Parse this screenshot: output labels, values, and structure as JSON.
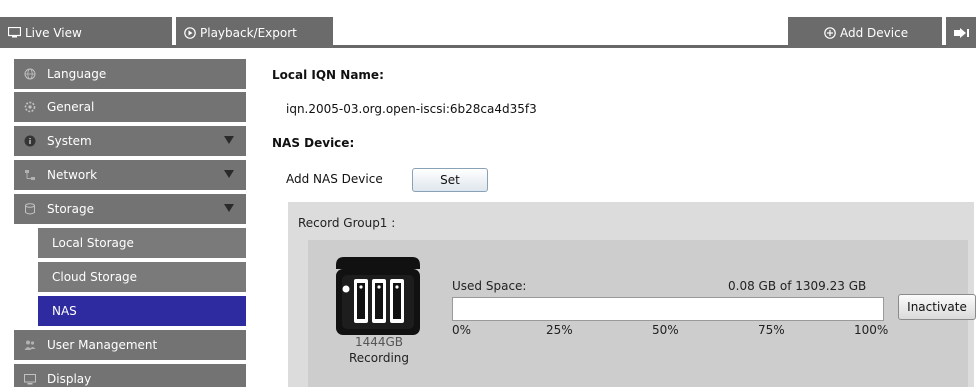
{
  "topbar": {
    "live_view": "Live View",
    "playback": "Playback/Export",
    "add_device": "Add Device"
  },
  "sidebar": {
    "items": [
      {
        "label": "Language",
        "icon": "globe-icon"
      },
      {
        "label": "General",
        "icon": "gear-icon"
      },
      {
        "label": "System",
        "icon": "info-icon"
      },
      {
        "label": "Network",
        "icon": "network-icon"
      },
      {
        "label": "Storage",
        "icon": "database-icon"
      }
    ],
    "storage_sub": [
      {
        "label": "Local Storage"
      },
      {
        "label": "Cloud Storage"
      },
      {
        "label": "NAS"
      }
    ],
    "more": [
      {
        "label": "User Management",
        "icon": "users-icon"
      },
      {
        "label": "Display",
        "icon": "monitor-icon"
      }
    ]
  },
  "main": {
    "iqn_label": "Local IQN Name:",
    "iqn_value": "iqn.2005-03.org.open-iscsi:6b28ca4d35f3",
    "nas_label": "NAS Device:",
    "add_nas_label": "Add NAS Device",
    "set_label": "Set",
    "group": {
      "title": "Record Group1 :",
      "capacity": "1444GB",
      "status": "Recording",
      "used_label": "Used Space:",
      "used_value": "0.08 GB of 1309.23 GB",
      "used_fraction": 0.0001,
      "ticks": [
        "0%",
        "25%",
        "50%",
        "75%",
        "100%"
      ],
      "inactivate_label": "Inactivate"
    }
  },
  "colors": {
    "menu_bg": "#737373",
    "active_bg": "#2e2aa0",
    "bar_fill": "#3a7bd5"
  }
}
